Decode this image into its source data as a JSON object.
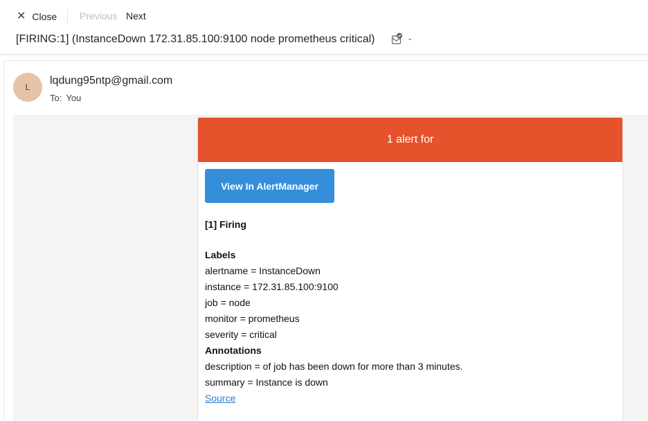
{
  "toolbar": {
    "close_label": "Close",
    "previous_label": "Previous",
    "next_label": "Next"
  },
  "subject": "[FIRING:1] (InstanceDown 172.31.85.100:9100 node prometheus critical)",
  "message": {
    "avatar_initial": "L",
    "sender": "lqdung95ntp@gmail.com",
    "to_prefix": "To:",
    "to_value": "You"
  },
  "email": {
    "banner_text": "1 alert for",
    "button_label": "View In AlertManager",
    "firing_heading": "[1] Firing",
    "labels_heading": "Labels",
    "labels": [
      "alertname = InstanceDown",
      "instance = 172.31.85.100:9100",
      "job = node",
      "monitor = prometheus",
      "severity = critical"
    ],
    "annotations_heading": "Annotations",
    "annotations": [
      "description = of job has been down for more than 3 minutes.",
      "summary = Instance is down"
    ],
    "source_link": "Source"
  },
  "colors": {
    "banner": "#e6522c",
    "button": "#348eda",
    "link": "#2a7ad1",
    "avatar_bg": "#e4c3a8"
  },
  "icons": {
    "close": "close-icon",
    "subject_action": "mail-check-icon",
    "subject_menu": "chevron-down-icon"
  }
}
